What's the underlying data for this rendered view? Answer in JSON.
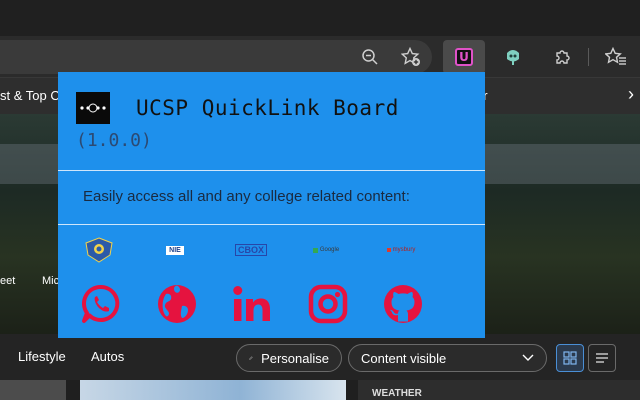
{
  "browser": {
    "icons": [
      "zoom-out-icon",
      "add-favorite-icon",
      "ucsp-extension-icon",
      "copilot-icon",
      "extensions-icon",
      "favorites-icon"
    ],
    "extension_letter": "U"
  },
  "page": {
    "nav_left": "st & Top C",
    "nav_right": "er",
    "quick_links": [
      "eet",
      "Mic"
    ],
    "lower_nav": [
      "Lifestyle",
      "Autos"
    ],
    "personalise_label": "Personalise",
    "content_select": "Content visible",
    "weather_label": "WEATHER"
  },
  "popup": {
    "title": "UCSP QuickLink Board",
    "version": "(1.0.0)",
    "description": "Easily access all and any college related content:",
    "links": [
      {
        "name": "college-emblem",
        "label": ""
      },
      {
        "name": "nie-portal",
        "label": "NIE"
      },
      {
        "name": "cbox",
        "label": "CBOX"
      },
      {
        "name": "google-classroom",
        "label": "Google"
      },
      {
        "name": "mysbury",
        "label": "mysbury"
      }
    ],
    "socials": [
      "whatsapp-icon",
      "globe-icon",
      "linkedin-icon",
      "instagram-icon",
      "github-icon"
    ]
  },
  "colors": {
    "popup_bg": "#1e90ec",
    "social_red": "#e5133f",
    "extension_accent": "#e052c8"
  }
}
